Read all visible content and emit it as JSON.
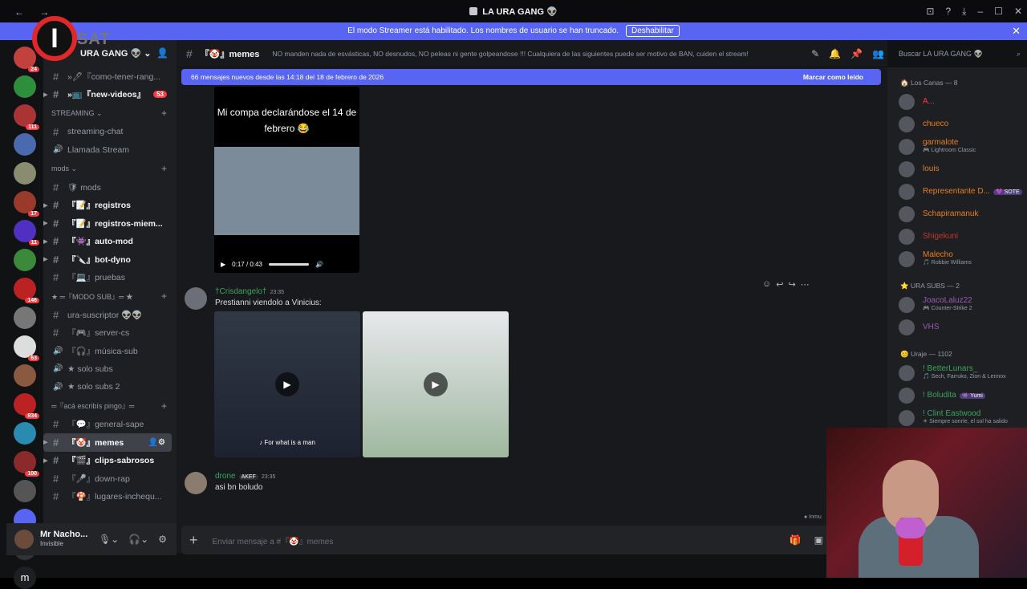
{
  "window": {
    "title": "LA URA GANG 👽",
    "nav": "← →",
    "controls": [
      "⊡",
      "?",
      "⤓",
      "–",
      "☐",
      "✕"
    ]
  },
  "streamer_banner": {
    "text": "El modo Streamer está habilitado. Los nombres de usuario se han truncado.",
    "button": "Deshabilitar",
    "close": "✕"
  },
  "overlay_logo": {
    "letter": "I",
    "text": "SAT"
  },
  "servers": [
    {
      "badge": "24",
      "color": "#c2413c"
    },
    {
      "badge": "",
      "color": "#2d8f3c"
    },
    {
      "badge": "111",
      "color": "#a33"
    },
    {
      "badge": "",
      "color": "#4a6ab0"
    },
    {
      "badge": "",
      "color": "#8a8c70"
    },
    {
      "badge": "17",
      "color": "#9a3a2a"
    },
    {
      "badge": "11",
      "color": "#5030c0"
    },
    {
      "badge": "",
      "color": "#3b8a3b"
    },
    {
      "badge": "146",
      "color": "#b22"
    },
    {
      "badge": "",
      "color": "#777"
    },
    {
      "badge": "63",
      "color": "#ddd"
    },
    {
      "badge": "",
      "color": "#8a5a40"
    },
    {
      "badge": "834",
      "color": "#b22"
    },
    {
      "badge": "",
      "color": "#2a8ab0"
    },
    {
      "badge": "100",
      "color": "#8a2a2a"
    },
    {
      "badge": "",
      "color": "#555"
    },
    {
      "badge": "",
      "color": "#5865f2"
    },
    {
      "badge": "",
      "color": "#333"
    }
  ],
  "server_tail": "m",
  "sidebar": {
    "server_name": "URA GANG 👽",
    "items": [
      {
        "type": "channel",
        "label": "»🖊『como-tener-rang...",
        "bold": false,
        "badge": ""
      },
      {
        "type": "channel",
        "label": "»📺『new-videos』",
        "bold": true,
        "badge": "53"
      },
      {
        "type": "category",
        "label": "STREAMING ⌄"
      },
      {
        "type": "channel",
        "label": "streaming-chat",
        "bold": false,
        "badge": ""
      },
      {
        "type": "voice",
        "label": "Llamada Stream",
        "bold": false,
        "badge": ""
      },
      {
        "type": "category",
        "label": "mods ⌄"
      },
      {
        "type": "channel",
        "label": "🛡 mods",
        "bold": false,
        "badge": ""
      },
      {
        "type": "channel",
        "label": "『📝』registros",
        "bold": true,
        "badge": ""
      },
      {
        "type": "channel",
        "label": "『📝』registros-miem...",
        "bold": true,
        "badge": ""
      },
      {
        "type": "channel",
        "label": "『👾』auto-mod",
        "bold": true,
        "badge": ""
      },
      {
        "type": "channel",
        "label": "『🔪』bot-dyno",
        "bold": true,
        "badge": ""
      },
      {
        "type": "channel",
        "label": "『💻』pruebas",
        "bold": false,
        "badge": ""
      },
      {
        "type": "category",
        "label": "★ ═『MODO SUB』═ ★"
      },
      {
        "type": "channel",
        "label": "ura-suscriptor 👽👽",
        "bold": false,
        "badge": ""
      },
      {
        "type": "channel",
        "label": "『🎮』server-cs",
        "bold": false,
        "badge": ""
      },
      {
        "type": "voice",
        "label": "『🎧』música-sub",
        "bold": false,
        "badge": ""
      },
      {
        "type": "voice",
        "label": "★ solo subs",
        "bold": false,
        "badge": ""
      },
      {
        "type": "voice",
        "label": "★ solo subs 2",
        "bold": false,
        "badge": ""
      },
      {
        "type": "category",
        "label": "═『acá escribís pingo』═"
      },
      {
        "type": "channel",
        "label": "『💬』general-sape",
        "bold": false,
        "badge": ""
      },
      {
        "type": "channel",
        "label": "『🤡』memes",
        "bold": true,
        "badge": "",
        "selected": true
      },
      {
        "type": "channel",
        "label": "『🎬』clips-sabrosos",
        "bold": true,
        "badge": ""
      },
      {
        "type": "channel",
        "label": "『🎤』down-rap",
        "bold": false,
        "badge": ""
      },
      {
        "type": "channel",
        "label": "『🍄』lugares-inchequ...",
        "bold": false,
        "badge": ""
      }
    ]
  },
  "user": {
    "name": "Mr Nacho...",
    "status": "Invisible"
  },
  "channel_header": {
    "name": "『🤡』memes",
    "topic": "NO manden nada de esvásticas, NO desnudos, NO peleas ni gente golpeandose !!! Cualquiera de las siguientes puede ser motivo de BAN, cuiden el stream!"
  },
  "search": {
    "placeholder": "Buscar LA URA GANG 👽"
  },
  "new_messages": {
    "text": "66 mensajes nuevos desde las 14:18 del 18 de febrero de 2026",
    "action": "Marcar como leído"
  },
  "tiktok": {
    "caption": "Mi compa declarándose el 14 de febrero 😂",
    "time": "0:17 / 0:43"
  },
  "messages": [
    {
      "author": "†Crisdangelo†",
      "time": "23:35",
      "text": "Prestianni viendolo a Vinicius:",
      "color": "#3ba55d",
      "video_caption": "♪ For what is a man"
    },
    {
      "author": "drone",
      "badge": "AKEF",
      "time": "23:35",
      "text": "asi bn boludo",
      "color": "#3ba55d"
    }
  ],
  "composer": {
    "placeholder": "Enviar mensaje a #『🤡』memes"
  },
  "members": {
    "groups": [
      {
        "label": "🏠 Los Canas — 8",
        "members": [
          {
            "name": "A...",
            "activity": "",
            "color": "#f23f43"
          },
          {
            "name": "chueco",
            "activity": "",
            "color": "#e67e22"
          },
          {
            "name": "garmalote",
            "activity": "🎮 Lightroom Classic",
            "color": "#e67e22"
          },
          {
            "name": "louis",
            "activity": "",
            "color": "#e67e22"
          },
          {
            "name": "Representante D...",
            "activity": "",
            "color": "#e67e22",
            "tag": "💜 SOTE"
          },
          {
            "name": "Schapiramanuk",
            "activity": "",
            "color": "#e67e22"
          },
          {
            "name": "Shigekuni",
            "activity": "",
            "color": "#c0392b"
          },
          {
            "name": "Malecho",
            "activity": "🎵 Robbie Williams",
            "color": "#e67e22"
          }
        ]
      },
      {
        "label": "⭐ URA SUBS — 2",
        "members": [
          {
            "name": "JoacoLaluz22",
            "activity": "🎮 Counter-Strike 2",
            "color": "#9b59b6"
          },
          {
            "name": "VHS",
            "activity": "",
            "color": "#9b59b6"
          }
        ]
      },
      {
        "label": "😊 Uraje — 1102",
        "members": [
          {
            "name": "! BetterLunars_",
            "activity": "🎵 Sech, Farruko, Zion & Lennox",
            "color": "#3ba55d"
          },
          {
            "name": "! Boludita",
            "activity": "",
            "color": "#3ba55d",
            "tag": "👾 Yumi"
          },
          {
            "name": "! Clint Eastwood",
            "activity": "☀ Siempre sonríe, el sol ha salido",
            "color": "#3ba55d"
          }
        ]
      }
    ]
  },
  "inmu": "● Inmu"
}
